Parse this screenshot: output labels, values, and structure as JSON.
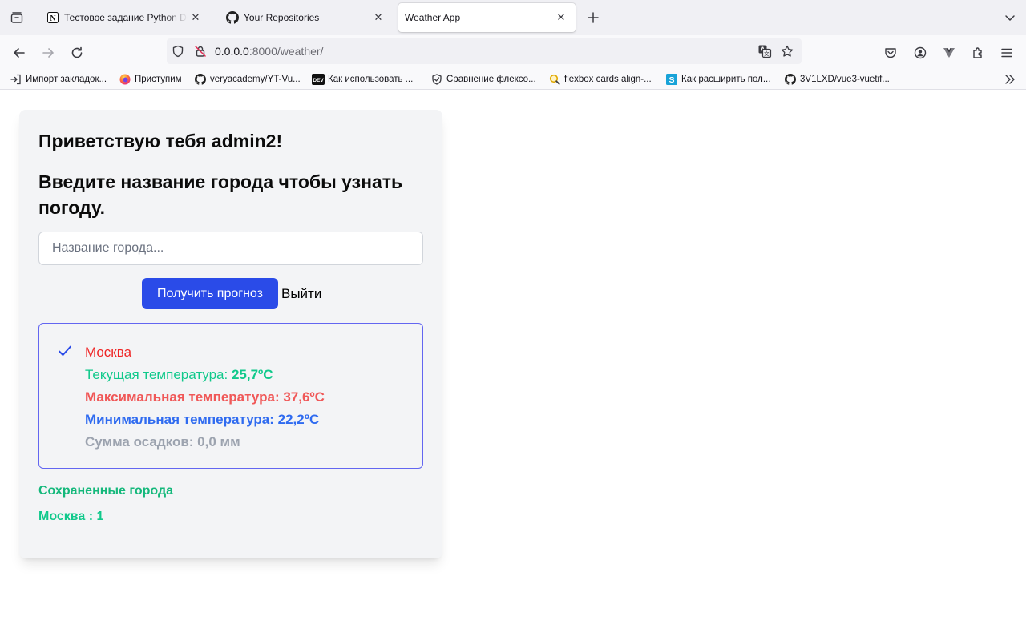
{
  "browser": {
    "tabs": [
      {
        "title": "Тестовое задание Python Deve",
        "icon": "notion-icon"
      },
      {
        "title": "Your Repositories",
        "icon": "github-icon"
      },
      {
        "title": "Weather App",
        "icon": "none",
        "active": true
      }
    ],
    "url": {
      "host": "0.0.0.0",
      "path": ":8000/weather/"
    },
    "bookmarks": [
      {
        "label": "Импорт закладок...",
        "icon": "import-icon"
      },
      {
        "label": "Приступим",
        "icon": "firefox-icon"
      },
      {
        "label": "veryacademy/YT-Vu...",
        "icon": "github-icon"
      },
      {
        "label": "Как использовать ...",
        "icon": "dev-icon"
      },
      {
        "label": "Сравнение флексо...",
        "icon": "shield-icon"
      },
      {
        "label": "flexbox cards align-...",
        "icon": "search-icon"
      },
      {
        "label": "Как расширить пол...",
        "icon": "s-icon"
      },
      {
        "label": "3V1LXD/vue3-vuetif...",
        "icon": "github-icon"
      }
    ]
  },
  "page": {
    "greeting": "Приветствую тебя admin2!",
    "prompt": "Введите название города чтобы узнать погоду.",
    "input": {
      "value": "",
      "placeholder": "Название города..."
    },
    "forecast_button": "Получить прогноз",
    "logout_link": "Выйти",
    "result": {
      "city": "Москва",
      "current_label": "Текущая температура: ",
      "current_value": "25,7ºC",
      "max": "Максимальная температура: 37,6ºC",
      "min": "Минимальная температура: 22,2ºC",
      "precipitation": "Сумма осадков: 0,0 мм"
    },
    "saved_title": "Сохраненные города",
    "saved_cities": [
      "Москва : 1"
    ]
  },
  "colors": {
    "button": "#2a4be8",
    "city": "#ef2525",
    "current": "#10c98b",
    "max": "#f05858",
    "min": "#2f6bf0",
    "precipitation": "#9ca3af",
    "result_border": "#6366f1"
  }
}
